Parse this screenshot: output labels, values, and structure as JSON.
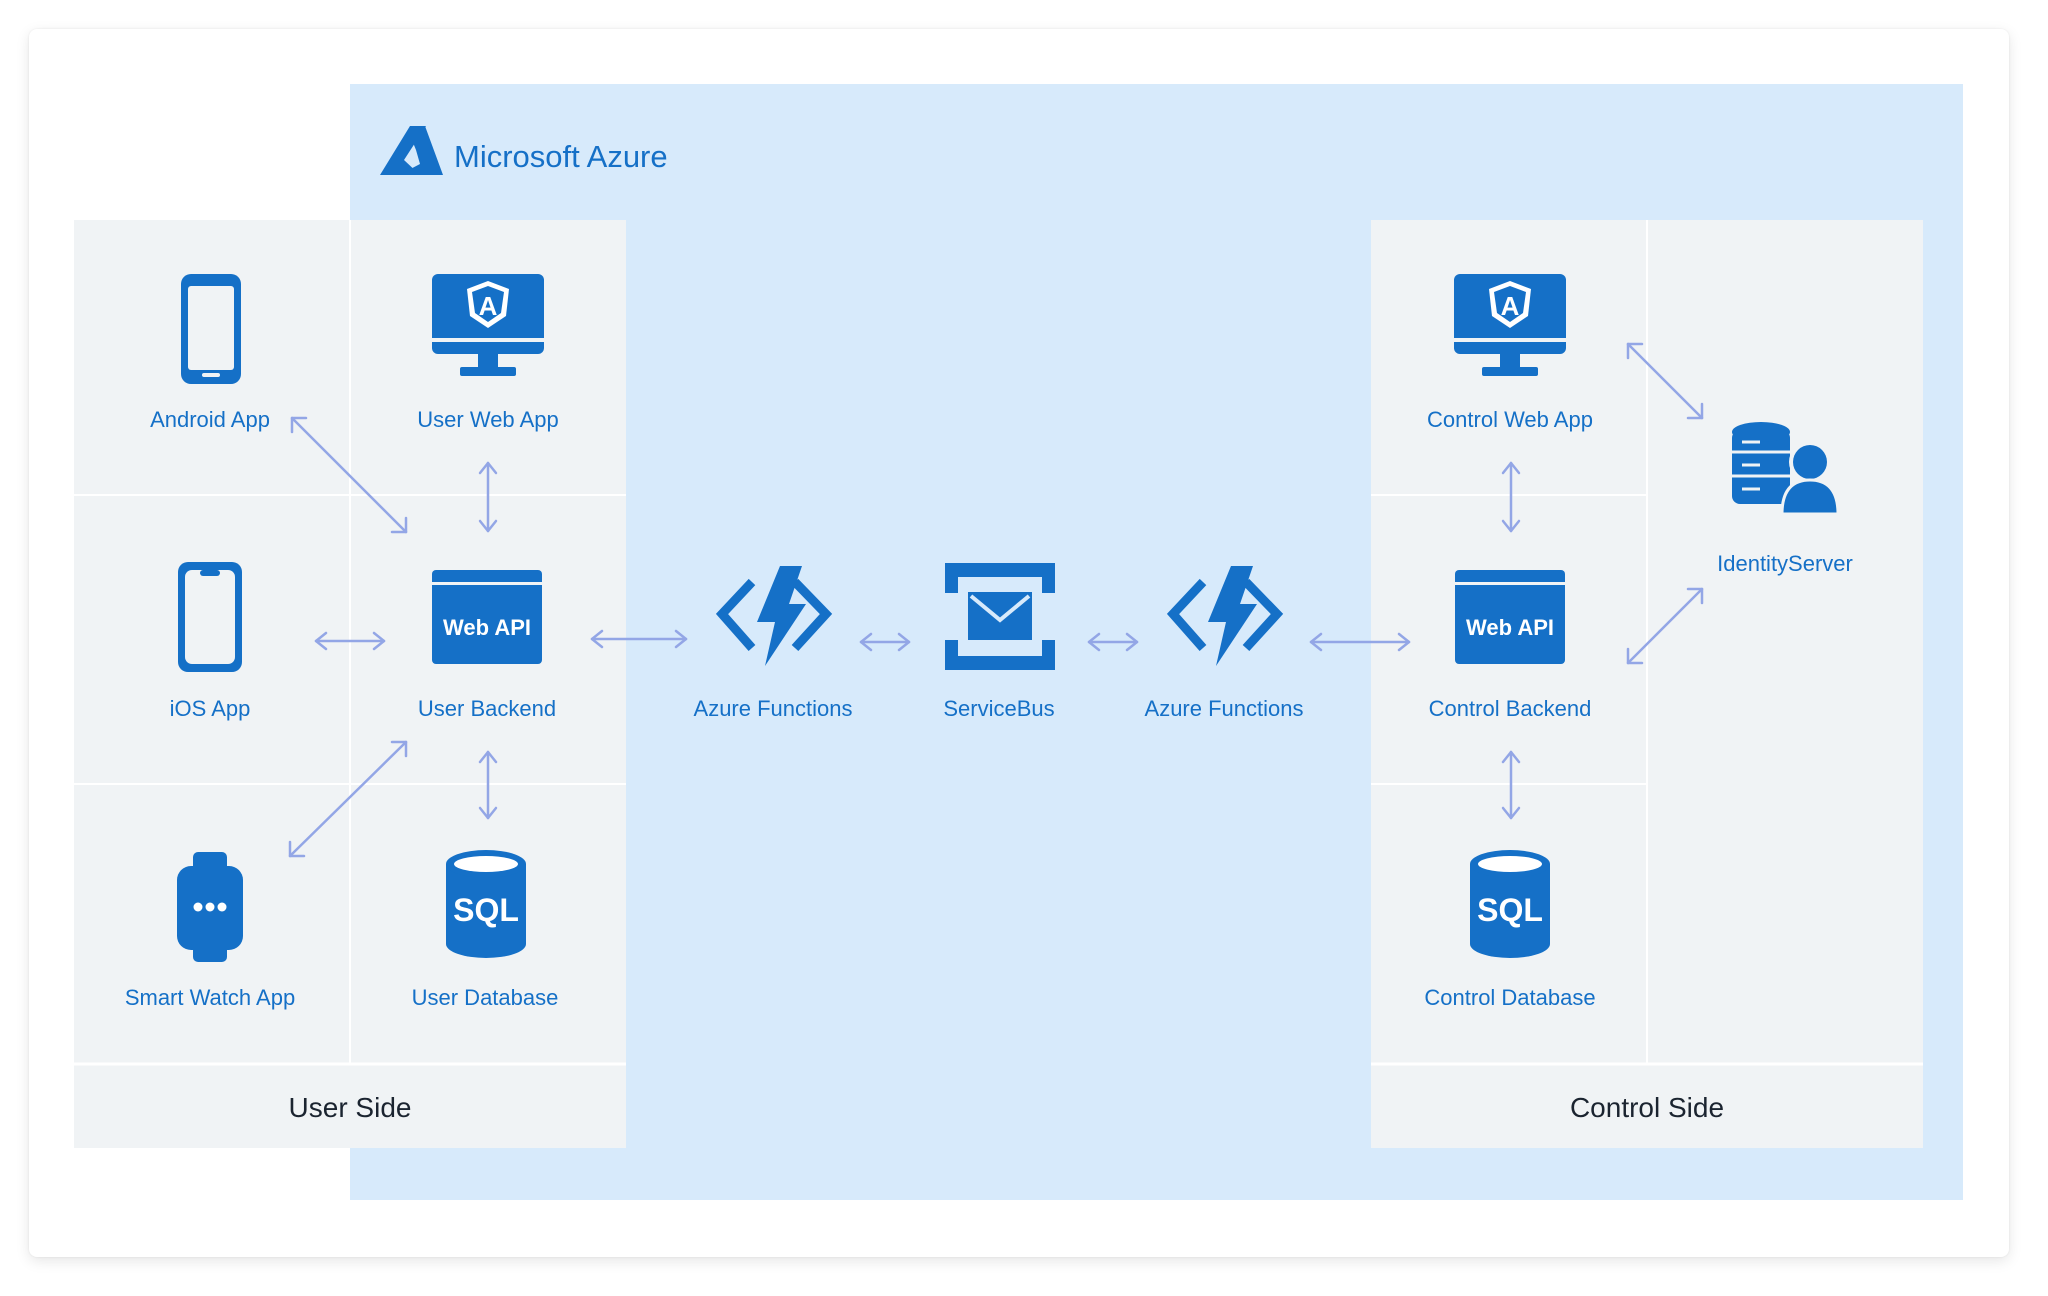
{
  "brand": {
    "name": "Microsoft Azure",
    "icon": "azure-logo-icon",
    "color": "#1570c7"
  },
  "colors": {
    "accent": "#1570c7",
    "cloud_background": "#d7eafb",
    "panel_background": "#f0f3f5",
    "arrow": "#93a6e6"
  },
  "groups": {
    "user_side": "User Side",
    "control_side": "Control Side"
  },
  "nodes": {
    "android_app": {
      "label": "Android App",
      "icon": "smartphone-icon"
    },
    "ios_app": {
      "label": "iOS App",
      "icon": "smartphone-icon"
    },
    "smart_watch_app": {
      "label": "Smart Watch App",
      "icon": "smartwatch-icon"
    },
    "user_web_app": {
      "label": "User Web App",
      "icon": "angular-monitor-icon"
    },
    "user_backend": {
      "label": "User Backend",
      "icon": "web-api-icon",
      "badge": "Web API"
    },
    "user_database": {
      "label": "User Database",
      "icon": "sql-database-icon",
      "badge": "SQL"
    },
    "azure_functions_left": {
      "label": "Azure Functions",
      "icon": "azure-functions-icon"
    },
    "service_bus": {
      "label": "ServiceBus",
      "icon": "service-bus-icon"
    },
    "azure_functions_right": {
      "label": "Azure Functions",
      "icon": "azure-functions-icon"
    },
    "control_web_app": {
      "label": "Control Web App",
      "icon": "angular-monitor-icon"
    },
    "control_backend": {
      "label": "Control Backend",
      "icon": "web-api-icon",
      "badge": "Web API"
    },
    "control_database": {
      "label": "Control Database",
      "icon": "sql-database-icon",
      "badge": "SQL"
    },
    "identity_server": {
      "label": "IdentityServer",
      "icon": "identity-server-icon"
    }
  },
  "connections": [
    {
      "from": "Android App",
      "to": "User Backend"
    },
    {
      "from": "iOS App",
      "to": "User Backend"
    },
    {
      "from": "Smart Watch App",
      "to": "User Backend"
    },
    {
      "from": "User Web App",
      "to": "User Backend"
    },
    {
      "from": "User Backend",
      "to": "User Database"
    },
    {
      "from": "User Backend",
      "to": "Azure Functions"
    },
    {
      "from": "Azure Functions",
      "to": "ServiceBus"
    },
    {
      "from": "ServiceBus",
      "to": "Azure Functions"
    },
    {
      "from": "Azure Functions",
      "to": "Control Backend"
    },
    {
      "from": "Control Web App",
      "to": "Control Backend"
    },
    {
      "from": "Control Backend",
      "to": "Control Database"
    },
    {
      "from": "Control Web App",
      "to": "IdentityServer"
    },
    {
      "from": "Control Backend",
      "to": "IdentityServer"
    }
  ]
}
